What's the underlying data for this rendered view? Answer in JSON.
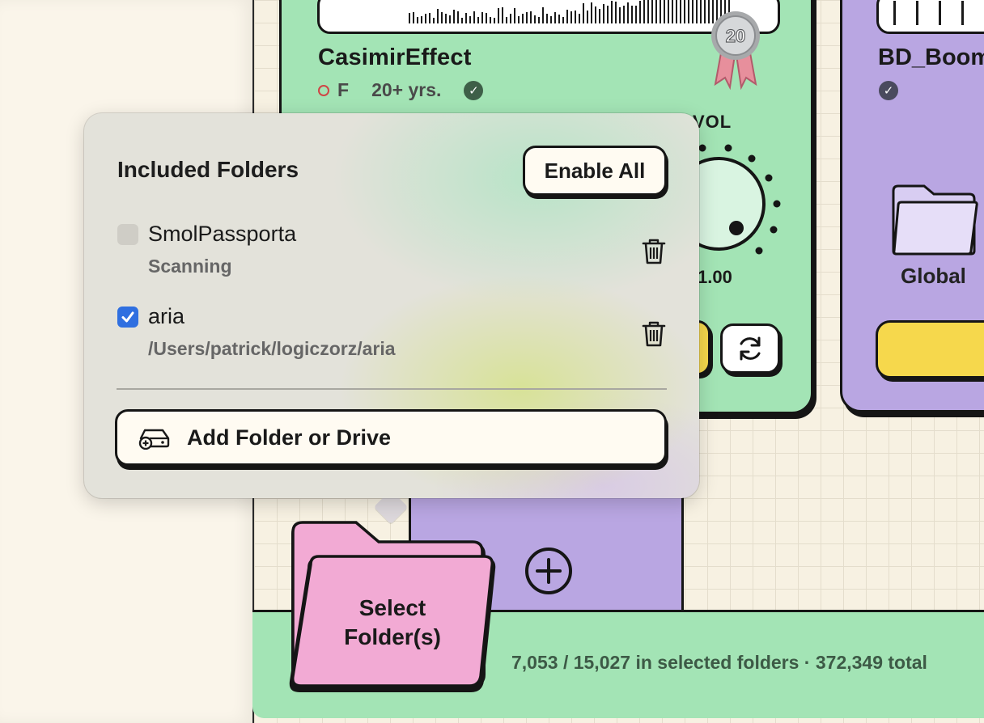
{
  "track": {
    "title": "CasimirEffect",
    "key": "F",
    "age": "20+ yrs.",
    "verified_glyph": "✓",
    "medal_text": "20",
    "vol_label": "VOL",
    "vol_value": "1.00"
  },
  "track2": {
    "title": "BD_Boom",
    "verified_glyph": "✓",
    "folder_label": "Global"
  },
  "library": {
    "select_label_line1": "Select",
    "select_label_line2": "Folder(s)",
    "stats": "7,053 / 15,027 in selected folders · 372,349 total"
  },
  "popover": {
    "title": "Included Folders",
    "enable_all_label": "Enable All",
    "folders": [
      {
        "name": "SmolPassporta",
        "detail": "Scanning",
        "checked": false
      },
      {
        "name": "aria",
        "detail": "/Users/patrick/logiczorz/aria",
        "checked": true
      }
    ],
    "add_label": "Add Folder or Drive"
  },
  "colors": {
    "green": "#a3e4b5",
    "purple": "#b9a6e2",
    "yellow": "#f6d84c",
    "pink": "#f2aad4",
    "checkbox_blue": "#2f6fe0"
  }
}
